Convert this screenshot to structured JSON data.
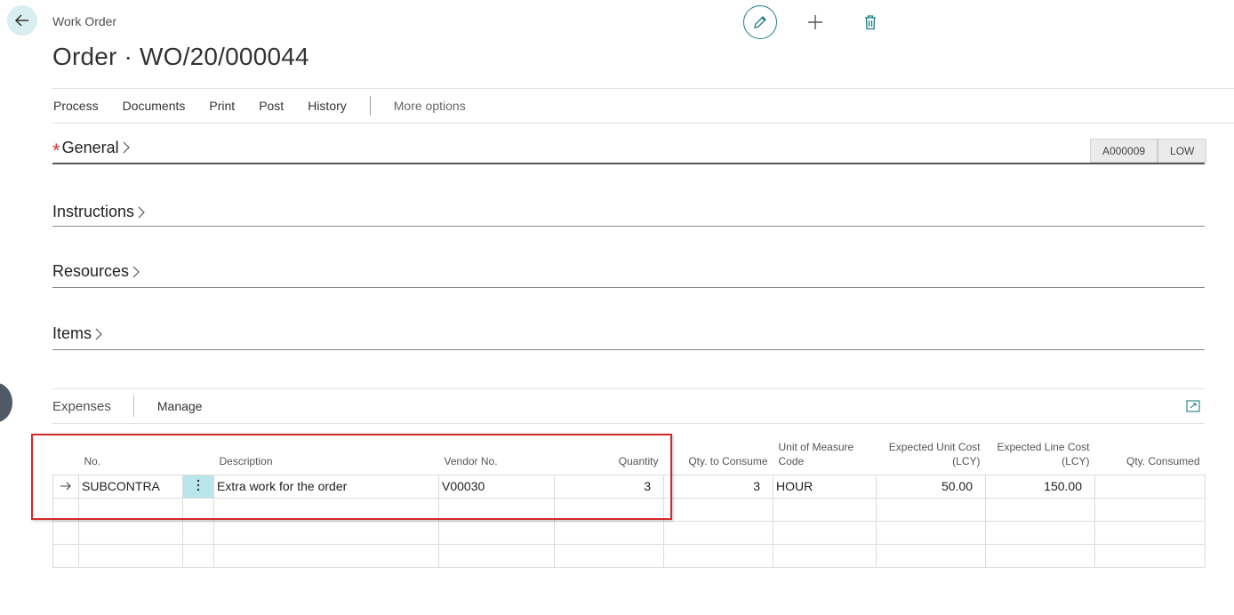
{
  "header": {
    "caption": "Work Order",
    "title": "Order · WO/20/000044"
  },
  "actions": [
    "Process",
    "Documents",
    "Print",
    "Post",
    "History"
  ],
  "more_options": "More options",
  "sections": {
    "general": "General",
    "instructions": "Instructions",
    "resources": "Resources",
    "items": "Items"
  },
  "tags": [
    "A000009",
    "LOW"
  ],
  "expenses": {
    "title": "Expenses",
    "manage": "Manage",
    "columns": {
      "no": "No.",
      "description": "Description",
      "vendor_no": "Vendor No.",
      "quantity": "Quantity",
      "qty_to_consume": "Qty. to Consume",
      "uom_line1": "Unit of Measure",
      "uom_line2": "Code",
      "unit_cost_line1": "Expected Unit Cost",
      "unit_cost_line2": "(LCY)",
      "line_cost_line1": "Expected Line Cost",
      "line_cost_line2": "(LCY)",
      "qty_consumed": "Qty. Consumed"
    },
    "rows": [
      {
        "no": "SUBCONTRA",
        "description": "Extra work for the order",
        "vendor_no": "V00030",
        "quantity": "3",
        "qty_to_consume": "3",
        "uom": "HOUR",
        "unit_cost": "50.00",
        "line_cost": "150.00",
        "qty_consumed": ""
      }
    ]
  },
  "colors": {
    "accent": "#1a7f86",
    "required": "#d13438",
    "highlight": "#d42a2a",
    "selected_cell": "#b9e6ea"
  }
}
